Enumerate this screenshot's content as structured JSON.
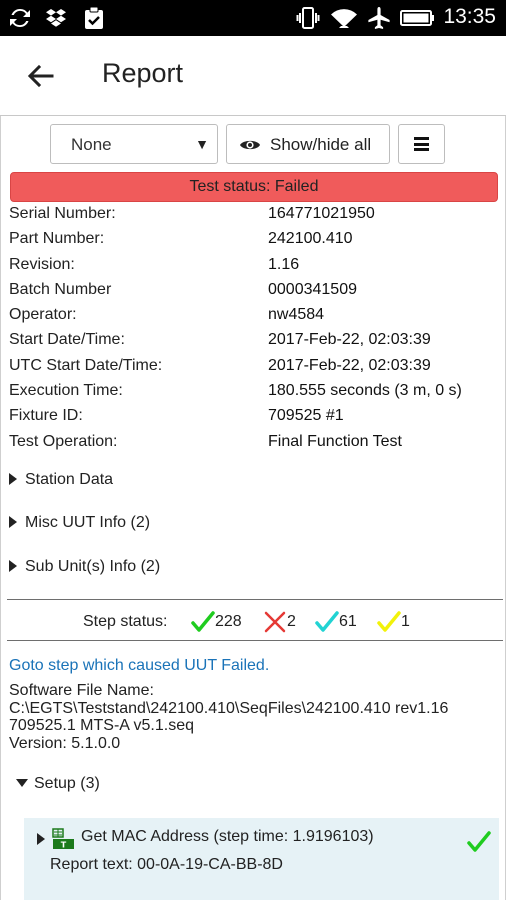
{
  "statusbar": {
    "time": "13:35",
    "icons": [
      "sync-icon",
      "dropbox-icon",
      "clipboard-check-icon",
      "vibrate-icon",
      "wifi-icon",
      "airplane-icon",
      "battery-icon"
    ]
  },
  "appbar": {
    "title": "Report"
  },
  "toolbar": {
    "filter_value": "None",
    "show_hide_label": "Show/hide all"
  },
  "test_status": "Test status: Failed",
  "colors": {
    "failed_banner": "#f05b5b",
    "pass": "#1fcc1f",
    "fail": "#e53935",
    "skipped": "#22d3d3",
    "other": "#f2f20a",
    "link": "#1a73b8",
    "step_bg": "#e6f2f6"
  },
  "info": [
    {
      "label": "Serial Number:",
      "value": "164771021950"
    },
    {
      "label": "Part Number:",
      "value": "242100.410"
    },
    {
      "label": "Revision:",
      "value": "1.16"
    },
    {
      "label": "Batch Number",
      "value": "0000341509"
    },
    {
      "label": "Operator:",
      "value": "nw4584"
    },
    {
      "label": "Start Date/Time:",
      "value": "2017-Feb-22, 02:03:39"
    },
    {
      "label": "UTC Start Date/Time:",
      "value": "2017-Feb-22, 02:03:39"
    },
    {
      "label": "Execution Time:",
      "value": "180.555 seconds (3 m, 0 s)"
    },
    {
      "label": "Fixture ID:",
      "value": "709525 #1"
    },
    {
      "label": "Test Operation:",
      "value": "Final Function Test"
    }
  ],
  "sections": [
    {
      "label": "Station Data"
    },
    {
      "label": "Misc UUT Info (2)"
    },
    {
      "label": "Sub Unit(s) Info (2)"
    }
  ],
  "step_status": {
    "label": "Step status:",
    "passed": "228",
    "failed": "2",
    "skipped": "61",
    "other": "1"
  },
  "goto_link": "Goto step which caused UUT Failed.",
  "software": {
    "line1": "Software File Name:",
    "line2": "C:\\EGTS\\Teststand\\242100.410\\SeqFiles\\242100.410 rev1.16",
    "line3": "709525.1 MTS-A v5.1.seq",
    "line4": "Version: 5.1.0.0"
  },
  "setup": {
    "label": "Setup (3)",
    "step": {
      "name": "Get MAC Address (step time: 1.9196103)",
      "report": "Report text: 00-0A-19-CA-BB-8D"
    }
  }
}
